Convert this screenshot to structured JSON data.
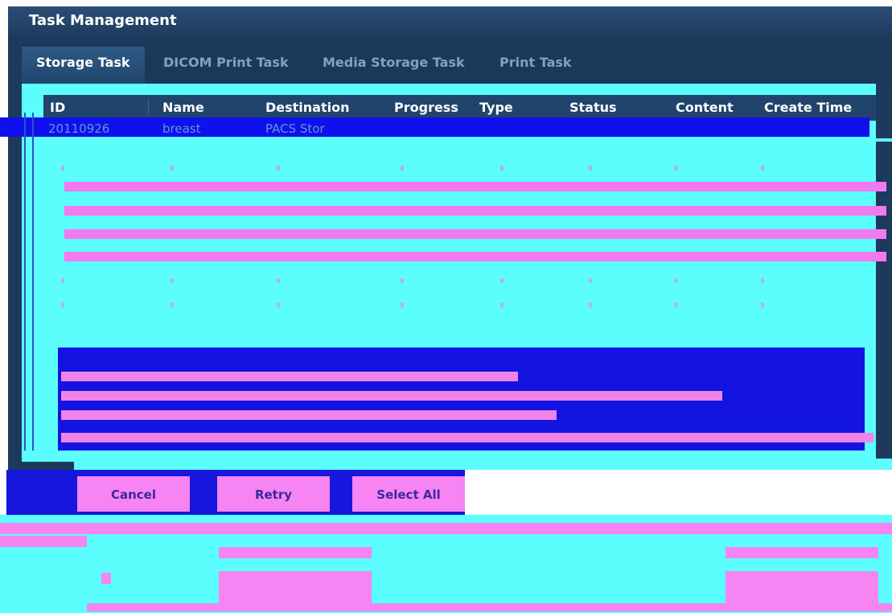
{
  "window": {
    "title": "Task Management"
  },
  "tabs": [
    {
      "label": "Storage Task",
      "active": true
    },
    {
      "label": "DICOM Print Task",
      "active": false
    },
    {
      "label": "Media Storage Task",
      "active": false
    },
    {
      "label": "Print Task",
      "active": false
    }
  ],
  "table": {
    "headers": [
      "ID",
      "Name",
      "Destination",
      "Progress",
      "Type",
      "Status",
      "Content",
      "Create Time"
    ],
    "rows": [
      {
        "id": "20110926",
        "name": "breast",
        "destination": "PACS Stor"
      }
    ]
  },
  "buttons": {
    "cancel": "Cancel",
    "retry": "Retry",
    "select_all": "Select All"
  },
  "colors": {
    "window_bg": "#1d3a5c",
    "header_bg": "#20446b",
    "accent_cyan": "#5bfdfd",
    "accent_magenta": "#f684f3",
    "selection_blue": "#1010ee"
  }
}
